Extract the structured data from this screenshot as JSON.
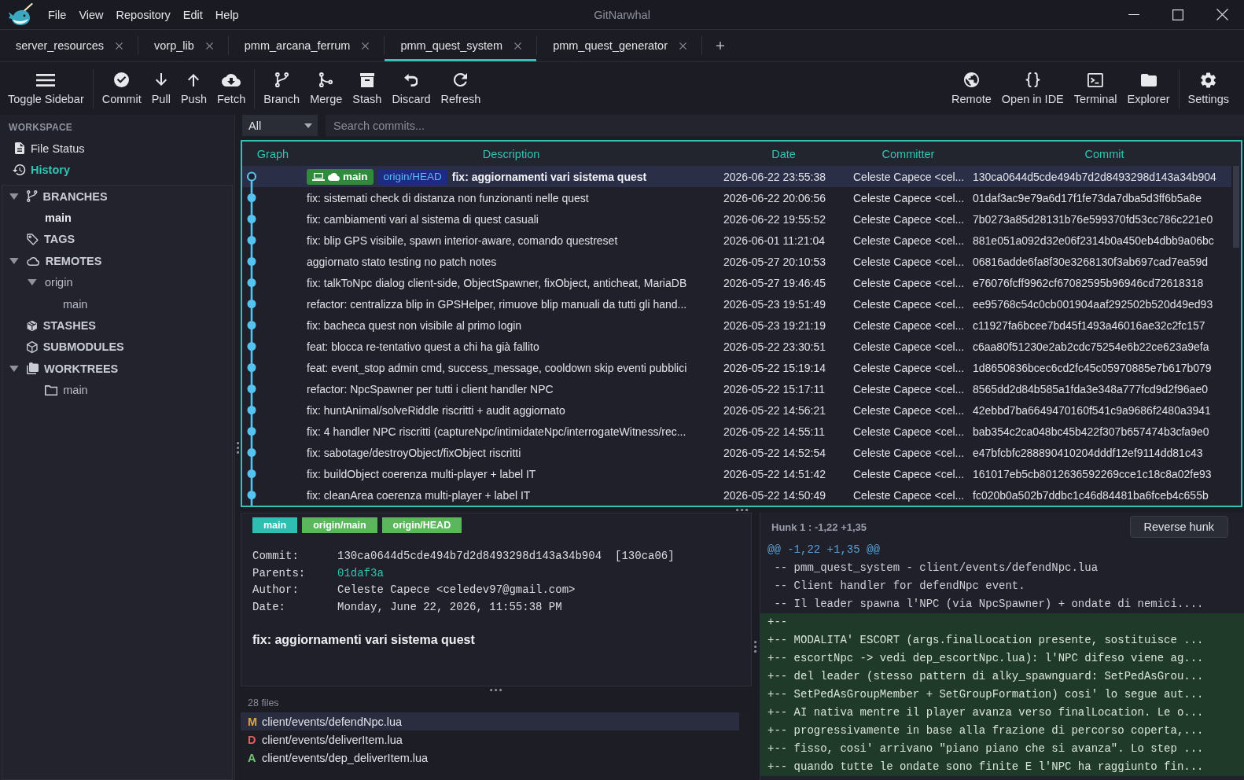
{
  "window": {
    "title": "GitNarwhal"
  },
  "menu": [
    "File",
    "View",
    "Repository",
    "Edit",
    "Help"
  ],
  "tabs": [
    {
      "label": "server_resources",
      "selected": false
    },
    {
      "label": "vorp_lib",
      "selected": false
    },
    {
      "label": "pmm_arcana_ferrum",
      "selected": false
    },
    {
      "label": "pmm_quest_system",
      "selected": true
    },
    {
      "label": "pmm_quest_generator",
      "selected": false
    }
  ],
  "toolbar": {
    "left_groups": [
      [
        "Toggle Sidebar"
      ],
      [
        "Commit",
        "Pull",
        "Push",
        "Fetch"
      ],
      [
        "Branch",
        "Merge",
        "Stash",
        "Discard",
        "Refresh"
      ]
    ],
    "right_groups": [
      [
        "Remote",
        "Open in IDE",
        "Terminal",
        "Explorer"
      ],
      [
        "Settings"
      ]
    ]
  },
  "sidebar": {
    "workspace": {
      "heading": "WORKSPACE",
      "items": [
        {
          "label": "File Status",
          "selected": false
        },
        {
          "label": "History",
          "selected": true
        }
      ]
    },
    "tree": [
      {
        "label": "BRANCHES",
        "expanded": true,
        "children": [
          {
            "label": "main",
            "current": true
          }
        ]
      },
      {
        "label": "TAGS"
      },
      {
        "label": "REMOTES",
        "expanded": true,
        "children": [
          {
            "label": "origin",
            "expanded": true,
            "children": [
              {
                "label": "main",
                "current": false
              }
            ]
          }
        ]
      },
      {
        "label": "STASHES"
      },
      {
        "label": "SUBMODULES"
      },
      {
        "label": "WORKTREES",
        "expanded": true,
        "children": [
          {
            "label": "main",
            "kind": "worktree"
          }
        ]
      }
    ]
  },
  "history": {
    "scope": "All",
    "search_placeholder": "Search commits...",
    "columns": [
      "Graph",
      "Description",
      "Date",
      "Committer",
      "Commit"
    ],
    "rows": [
      {
        "head": true,
        "selected": true,
        "refs": [
          {
            "label": "main",
            "kind": "local",
            "pushed": true
          },
          {
            "label": "origin/HEAD",
            "kind": "remote"
          }
        ],
        "description": "fix: aggiornamenti vari sistema quest",
        "date": "2026-06-22 23:55:38",
        "committer": "Celeste Capece <cel...",
        "hash": "130ca0644d5cde494b7d2d8493298d143a34b904"
      },
      {
        "head": false,
        "selected": false,
        "description": "fix: sistemati check di distanza non funzionanti nelle quest",
        "date": "2026-06-22 20:06:56",
        "committer": "Celeste Capece <cel...",
        "hash": "01daf3ac9e79a6d17f1fe73da7dba5d3ff6b5a8e"
      },
      {
        "head": false,
        "selected": false,
        "description": "fix: cambiamenti vari al sistema di quest casuali",
        "date": "2026-06-22 19:55:52",
        "committer": "Celeste Capece <cel...",
        "hash": "7b0273a85d28131b76e599370fd53cc786c221e0"
      },
      {
        "head": false,
        "selected": false,
        "description": "fix: blip GPS visibile, spawn interior-aware, comando questreset",
        "date": "2026-06-01 11:21:04",
        "committer": "Celeste Capece <cel...",
        "hash": "881e051a092d32e06f2314b0a450eb4dbb9a06bc"
      },
      {
        "head": false,
        "selected": false,
        "description": "aggiornato stato testing no patch notes",
        "date": "2026-05-27 20:10:53",
        "committer": "Celeste Capece <cel...",
        "hash": "06816adde6fa8f30e3268130f3ab697cad7ea59d"
      },
      {
        "head": false,
        "selected": false,
        "description": "fix: talkToNpc dialog client-side, ObjectSpawner, fixObject, anticheat, MariaDB",
        "date": "2026-05-27 19:46:45",
        "committer": "Celeste Capece <cel...",
        "hash": "e76076fcff9962cf67082595b96946cd72618318"
      },
      {
        "head": false,
        "selected": false,
        "description": "refactor: centralizza blip in GPSHelper, rimuove blip manuali da tutti gli hand...",
        "date": "2026-05-23 19:51:49",
        "committer": "Celeste Capece <cel...",
        "hash": "ee95768c54c0cb001904aaf292502b520d49ed93"
      },
      {
        "head": false,
        "selected": false,
        "description": "fix: bacheca quest non visibile al primo login",
        "date": "2026-05-23 19:21:19",
        "committer": "Celeste Capece <cel...",
        "hash": "c11927fa6bcee7bd45f1493a46016ae32c2fc157"
      },
      {
        "head": false,
        "selected": false,
        "description": "feat: blocca re-tentativo quest a chi ha già fallito",
        "date": "2026-05-22 23:30:51",
        "committer": "Celeste Capece <cel...",
        "hash": "c6aa80f51230e2ab2cdc75254e6b22ce623a9efa"
      },
      {
        "head": false,
        "selected": false,
        "description": "feat: event_stop admin cmd, success_message, cooldown skip eventi pubblici",
        "date": "2026-05-22 15:19:14",
        "committer": "Celeste Capece <cel...",
        "hash": "1d8650836bcec6cd2fc45c05970885e7b617b079"
      },
      {
        "head": false,
        "selected": false,
        "description": "refactor: NpcSpawner per tutti i client handler NPC",
        "date": "2026-05-22 15:17:11",
        "committer": "Celeste Capece <cel...",
        "hash": "8565dd2d84b585a1fda3e348a777fcd9d2f96ae0"
      },
      {
        "head": false,
        "selected": false,
        "description": "fix: huntAnimal/solveRiddle riscritti + audit aggiornato",
        "date": "2026-05-22 14:56:21",
        "committer": "Celeste Capece <cel...",
        "hash": "42ebbd7ba6649470160f541c9a9686f2480a3941"
      },
      {
        "head": false,
        "selected": false,
        "description": "fix: 4 handler NPC riscritti (captureNpc/intimidateNpc/interrogateWitness/rec...",
        "date": "2026-05-22 14:55:11",
        "committer": "Celeste Capece <cel...",
        "hash": "bab354c2ca048bc45b422f307b657474b3cfa9e0"
      },
      {
        "head": false,
        "selected": false,
        "description": "fix: sabotage/destroyObject/fixObject riscritti",
        "date": "2026-05-22 14:52:54",
        "committer": "Celeste Capece <cel...",
        "hash": "e47bfcbfc288890410204dddf12ef9114dd81c43"
      },
      {
        "head": false,
        "selected": false,
        "description": "fix: buildObject coerenza multi-player + label IT",
        "date": "2026-05-22 14:51:42",
        "committer": "Celeste Capece <cel...",
        "hash": "161017eb5cb8012636592269cce1c18c8a02fe93"
      },
      {
        "head": false,
        "selected": false,
        "description": "fix: cleanArea coerenza multi-player + label IT",
        "date": "2026-05-22 14:50:49",
        "committer": "Celeste Capece <cel...",
        "hash": "fc020b0a502b7ddbc1c46d84481ba6fceb4c655b"
      }
    ]
  },
  "details": {
    "refs": [
      {
        "label": "main",
        "kind": "local"
      },
      {
        "label": "origin/main",
        "kind": "remote"
      },
      {
        "label": "origin/HEAD",
        "kind": "remote"
      }
    ],
    "fields": [
      {
        "label": "Commit:",
        "value": "130ca0644d5cde494b7d2d8493298d143a34b904",
        "short_hash": "[130ca06]",
        "kind": "text"
      },
      {
        "label": "Parents:",
        "value": "01daf3a",
        "kind": "link"
      },
      {
        "label": "Author:",
        "value": "Celeste Capece <celedev97@gmail.com>",
        "kind": "text"
      },
      {
        "label": "Date:",
        "value": "Monday, June 22, 2026, 11:55:38 PM",
        "kind": "text"
      }
    ],
    "message": "fix: aggiornamenti vari sistema quest",
    "file_count": "28 files",
    "files": [
      {
        "status": "M",
        "kind": "modified",
        "path": "client/events/defendNpc.lua",
        "selected": true
      },
      {
        "status": "D",
        "kind": "deleted",
        "path": "client/events/deliverItem.lua",
        "selected": false
      },
      {
        "status": "A",
        "kind": "added",
        "path": "client/events/dep_deliverItem.lua",
        "selected": false
      }
    ]
  },
  "diff": {
    "hunk_title": "Hunk 1 : -1,22 +1,35",
    "reverse_button": "Reverse hunk",
    "lines": [
      {
        "kind": "hunk",
        "text": "@@ -1,22 +1,35 @@"
      },
      {
        "kind": "context",
        "text": " -- pmm_quest_system - client/events/defendNpc.lua"
      },
      {
        "kind": "context",
        "text": " -- Client handler for defendNpc event."
      },
      {
        "kind": "context",
        "text": " -- Il leader spawna l'NPC (via NpcSpawner) + ondate di nemici...."
      },
      {
        "kind": "added",
        "text": "+--"
      },
      {
        "kind": "added",
        "text": "+-- MODALITA' ESCORT (args.finalLocation presente, sostituisce ..."
      },
      {
        "kind": "added",
        "text": "+-- escortNpc -> vedi dep_escortNpc.lua): l'NPC difeso viene ag..."
      },
      {
        "kind": "added",
        "text": "+-- del leader (stesso pattern di alky_spawnguard: SetPedAsGrou..."
      },
      {
        "kind": "added",
        "text": "+-- SetPedAsGroupMember + SetGroupFormation) cosi' lo segue aut..."
      },
      {
        "kind": "added",
        "text": "+-- AI nativa mentre il player avanza verso finalLocation. Le o..."
      },
      {
        "kind": "added",
        "text": "+-- progressivamente in base alla frazione di percorso coperta,..."
      },
      {
        "kind": "added",
        "text": "+-- fisso, cosi' arrivano \"piano piano che si avanza\". Lo step ..."
      },
      {
        "kind": "added",
        "text": "+-- quando tutte le ondate sono finite E l'NPC ha raggiunto fin..."
      }
    ]
  }
}
